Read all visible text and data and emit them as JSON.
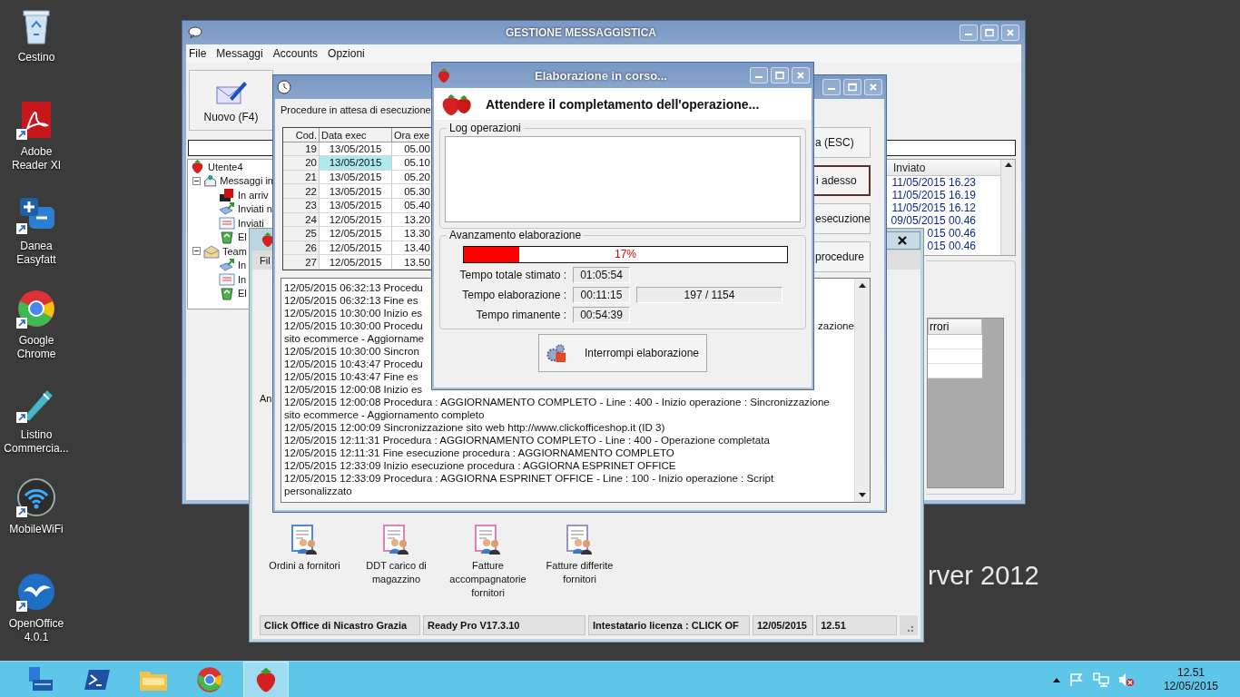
{
  "desktop": {
    "icons": [
      {
        "kind": "recycle-bin",
        "label": "Cestino",
        "shortcut": false
      },
      {
        "kind": "pdf",
        "label": "Adobe Reader XI",
        "shortcut": true
      },
      {
        "kind": "danea",
        "label": "Danea Easyfatt",
        "shortcut": true
      },
      {
        "kind": "chrome",
        "label": "Google Chrome",
        "shortcut": true
      },
      {
        "kind": "pen",
        "label": "Listino Commercia...",
        "shortcut": true
      },
      {
        "kind": "wifi",
        "label": "MobileWiFi",
        "shortcut": true
      },
      {
        "kind": "openoffice",
        "label": "OpenOffice 4.0.1",
        "shortcut": true
      }
    ],
    "branding": "rver 2012"
  },
  "main_window": {
    "title": "GESTIONE MESSAGGISTICA",
    "menu": [
      "File",
      "Messaggi",
      "Accounts",
      "Opzioni"
    ],
    "toolbar": [
      {
        "label": "Nuovo (F4)"
      }
    ],
    "tree": [
      {
        "label": "Utente4",
        "kind": "user",
        "children": [
          {
            "label": "Messaggi in",
            "kind": "mailbox",
            "expanded": true,
            "children": [
              {
                "label": "In arriv",
                "kind": "incoming"
              },
              {
                "label": "Inviati n",
                "kind": "outbox"
              },
              {
                "label": "Inviati",
                "kind": "sent"
              },
              {
                "label": "El",
                "kind": "recycle"
              }
            ]
          },
          {
            "label": "Team",
            "kind": "team",
            "expanded": true,
            "children": [
              {
                "label": "In",
                "kind": "outbox"
              },
              {
                "label": "In",
                "kind": "sent"
              },
              {
                "label": "El",
                "kind": "recycle"
              }
            ]
          }
        ]
      }
    ],
    "sent_list": {
      "columns": [
        "Inviato"
      ],
      "rows": [
        "11/05/2015 16.23",
        "11/05/2015 16.19",
        "11/05/2015 16.12",
        "09/05/2015 00.46",
        "015 00.46",
        "015 00.46"
      ]
    },
    "errors_table": {
      "columns": [
        "rrori"
      ]
    }
  },
  "procedures_window": {
    "heading": "Procedure in attesa di esecuzione",
    "columns": [
      "Cod.",
      "Data exec",
      "Ora exe"
    ],
    "rows": [
      {
        "cod": "19",
        "date": "13/05/2015",
        "time": "05.00",
        "selected": false
      },
      {
        "cod": "20",
        "date": "13/05/2015",
        "time": "05.10",
        "selected": true
      },
      {
        "cod": "21",
        "date": "13/05/2015",
        "time": "05.20",
        "selected": false
      },
      {
        "cod": "22",
        "date": "13/05/2015",
        "time": "05.30",
        "selected": false
      },
      {
        "cod": "23",
        "date": "13/05/2015",
        "time": "05.40",
        "selected": false
      },
      {
        "cod": "24",
        "date": "12/05/2015",
        "time": "13.20",
        "selected": false
      },
      {
        "cod": "25",
        "date": "12/05/2015",
        "time": "13.30",
        "selected": false
      },
      {
        "cod": "26",
        "date": "12/05/2015",
        "time": "13.40",
        "selected": false
      },
      {
        "cod": "27",
        "date": "12/05/2015",
        "time": "13.50",
        "selected": false
      }
    ],
    "buttons": [
      {
        "label": "a (ESC)",
        "focused": false
      },
      {
        "label": "i adesso",
        "focused": true
      },
      {
        "label": "esecuzione",
        "focused": false
      },
      {
        "label": "procedure",
        "focused": false
      }
    ],
    "log": [
      {
        "text": "12/05/2015 06:32:13 Procedu"
      },
      {
        "text": "12/05/2015 06:32:13 Fine es"
      },
      {
        "text": "12/05/2015 10:30:00 Inizio es"
      },
      {
        "text": "12/05/2015 10:30:00 Procedu",
        "tail": "zazione"
      },
      {
        "text": "sito ecommerce - Aggiorname"
      },
      {
        "text": "12/05/2015 10:30:00 Sincron"
      },
      {
        "text": "12/05/2015 10:43:47 Procedu"
      },
      {
        "text": "12/05/2015 10:43:47 Fine es"
      },
      {
        "text": "12/05/2015 12:00:08 Inizio es"
      },
      {
        "text": "12/05/2015 12:00:08 Procedura : AGGIORNAMENTO COMPLETO - Line : 400 - Inizio operazione : Sincronizzazione"
      },
      {
        "text": "sito ecommerce - Aggiornamento completo"
      },
      {
        "text": "12/05/2015 12:00:09 Sincronizzazione sito web http://www.clickofficeshop.it (ID 3)"
      },
      {
        "text": "12/05/2015 12:11:31 Procedura : AGGIORNAMENTO COMPLETO - Line : 400 - Operazione completata"
      },
      {
        "text": "12/05/2015 12:11:31 Fine esecuzione procedura : AGGIORNAMENTO COMPLETO"
      },
      {
        "text": "12/05/2015 12:33:09 Inizio esecuzione procedura : AGGIORNA ESPRINET OFFICE"
      },
      {
        "text": "12/05/2015 12:33:09 Procedura : AGGIORNA ESPRINET OFFICE - Line : 100 - Inizio operazione : Script"
      },
      {
        "text": "personalizzato"
      }
    ]
  },
  "progress_dialog": {
    "title": "Elaborazione in corso...",
    "heading": "Attendere il completamento dell'operazione...",
    "log_label": "Log operazioni",
    "progress_label": "Avanzamento elaborazione",
    "level": 0.17,
    "percent": "17%",
    "rows": [
      {
        "label": "Tempo totale stimato :",
        "value": "01:05:54"
      },
      {
        "label": "Tempo elaborazione :",
        "value": "00:11:15",
        "extra": "197 / 1154"
      },
      {
        "label": "Tempo rimanente :",
        "value": "00:54:39"
      }
    ],
    "button": "Interrompi elaborazione"
  },
  "readypro_window": {
    "menu": [
      "Fil"
    ],
    "side_label": "An",
    "shortcuts": [
      {
        "label": "Ordini a fornitori",
        "color": "#4f86e8"
      },
      {
        "label": "DDT carico di magazzino",
        "color": "#e27fb4"
      },
      {
        "label": "Fatture accompagnatorie fornitori",
        "color": "#e27fb4"
      },
      {
        "label": "Fatture differite fornitori",
        "color": "#9a92cf"
      }
    ],
    "status": [
      "Click Office di Nicastro Grazia",
      "Ready Pro V17.3.10",
      "Intestatario licenza : CLICK OF",
      "12/05/2015",
      "12.51"
    ]
  },
  "taskbar": {
    "apps": [
      {
        "kind": "server-manager",
        "selected": false
      },
      {
        "kind": "powershell",
        "selected": false
      },
      {
        "kind": "explorer",
        "selected": false
      },
      {
        "kind": "chrome",
        "selected": false
      },
      {
        "kind": "strawberry",
        "selected": true
      }
    ],
    "clock": {
      "time": "12.51",
      "date": "12/05/2015"
    }
  }
}
